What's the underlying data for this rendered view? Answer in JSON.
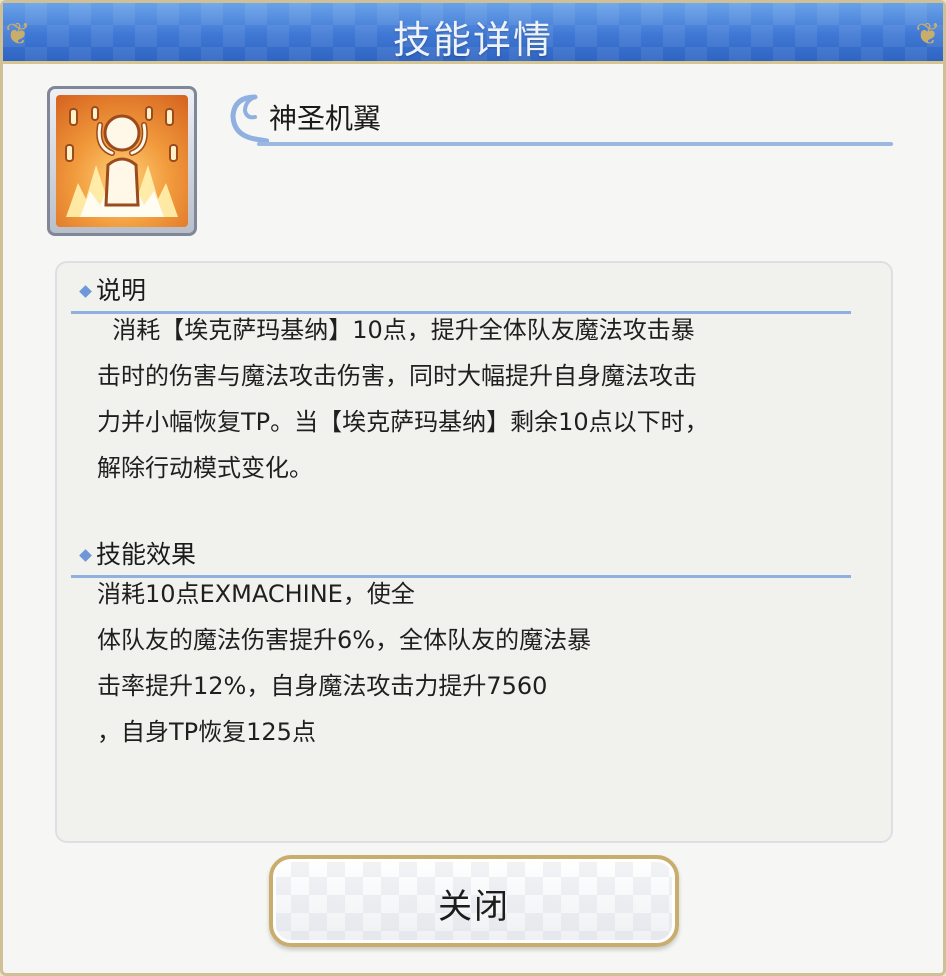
{
  "dialog": {
    "title": "技能详情"
  },
  "skill": {
    "name": "神圣机翼",
    "icon": "skill-charge-icon"
  },
  "description": {
    "heading": "说明",
    "lines": [
      "  消耗【埃克萨玛基纳】10点，提升全体队友魔法攻击暴",
      "击时的伤害与魔法攻击伤害，同时大幅提升自身魔法攻击",
      "力并小幅恢复TP。当【埃克萨玛基纳】剩余10点以下时，",
      "解除行动模式变化。"
    ]
  },
  "effect": {
    "heading": "技能效果",
    "lines": [
      "消耗10点EXMACHINE，使全",
      "体队友的魔法伤害提升6%，全体队友的魔法暴",
      "击率提升12%，自身魔法攻击力提升7560",
      "，自身TP恢复125点"
    ]
  },
  "footer": {
    "close_label": "关闭"
  },
  "colors": {
    "title_bar": "#3f78d4",
    "accent_rule": "#8fb0e0",
    "border_gold": "#c9ad6c",
    "panel_bg": "#f1f1ee"
  }
}
